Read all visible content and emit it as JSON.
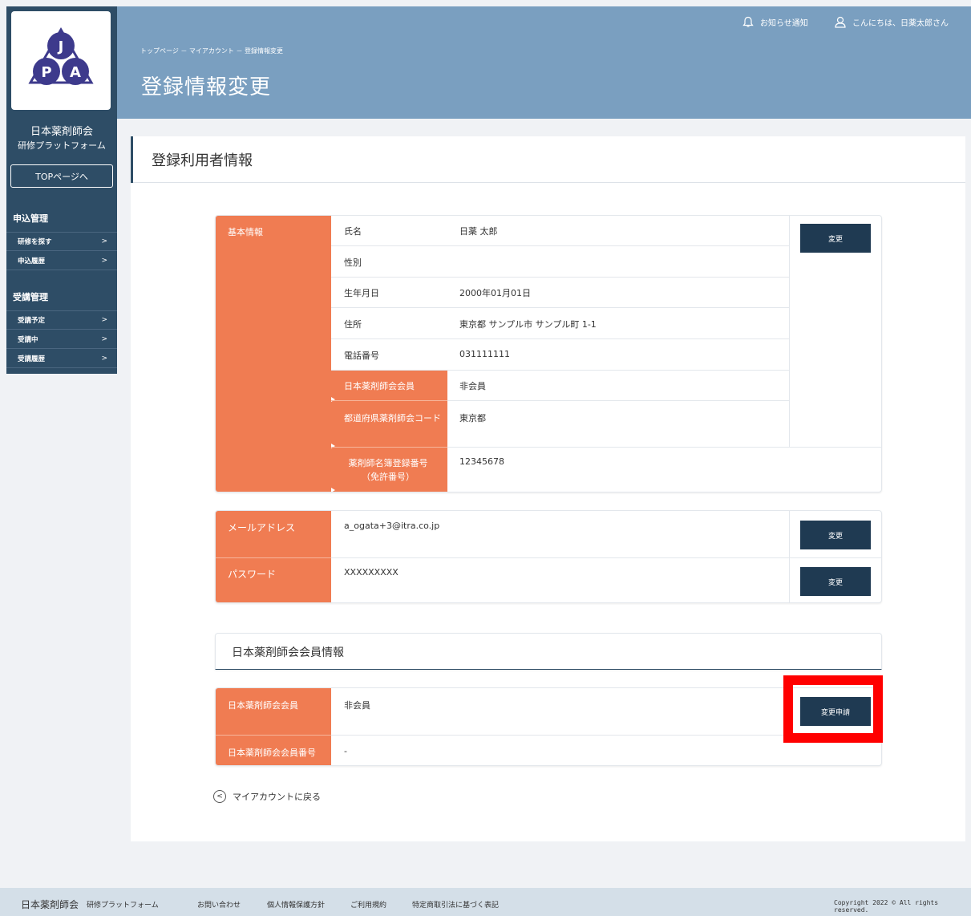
{
  "header": {
    "notifications": "お知らせ通知",
    "greeting": "こんにちは、日薬太郎さん",
    "breadcrumb": "トップページ － マイアカウント － 登録情報変更",
    "page_title": "登録情報変更"
  },
  "sidebar": {
    "logo_text": "JPA",
    "org_name": "日本薬剤師会",
    "org_sub": "研修プラットフォーム",
    "top_button": "TOPページへ",
    "sections": [
      {
        "title": "申込管理",
        "items": [
          "研修を探す",
          "申込履歴"
        ]
      },
      {
        "title": "受講管理",
        "items": [
          "受講予定",
          "受講中",
          "受講履歴"
        ]
      }
    ],
    "chevron": ">"
  },
  "card": {
    "title": "登録利用者情報",
    "basic": {
      "section_label": "基本情報",
      "rows": [
        {
          "label": "氏名",
          "value": "日薬 太郎"
        },
        {
          "label": "性別",
          "value": ""
        },
        {
          "label": "生年月日",
          "value": "2000年01月01日"
        },
        {
          "label": "住所",
          "value": "東京都 サンプル市 サンプル町 1-1"
        },
        {
          "label": "電話番号",
          "value": "031111111"
        },
        {
          "label": "日本薬剤師会会員",
          "value": "非会員"
        },
        {
          "label": "都道府県薬剤師会コード",
          "value": "東京都"
        },
        {
          "label": "薬剤師名簿登録番号（免許番号）",
          "value": "12345678"
        }
      ],
      "change_button": "変更"
    },
    "account": {
      "email_label": "メールアドレス",
      "email_value": "a_ogata+3@itra.co.jp",
      "email_button": "変更",
      "password_label": "パスワード",
      "password_value": "XXXXXXXXX",
      "password_button": "変更"
    },
    "member": {
      "title": "日本薬剤師会会員情報",
      "member_label": "日本薬剤師会会員",
      "member_value": "非会員",
      "member_number_label": "日本薬剤師会会員番号",
      "member_number_value": "-",
      "change_request_button": "変更申請"
    },
    "back_link": "マイアカウントに戻る",
    "back_icon": "<"
  },
  "footer": {
    "org_name": "日本薬剤師会",
    "org_sub": "研修プラットフォーム",
    "links": [
      "お問い合わせ",
      "個人情報保護方針",
      "ご利用規約",
      "特定商取引法に基づく表記"
    ],
    "copyright": "Copyright 2022 © All rights reserved."
  },
  "colors": {
    "sidebar": "#2e4d66",
    "header": "#7a9fc0",
    "accent_orange": "#f07c52",
    "button_dark": "#1f3a52",
    "highlight_red": "#ff0000"
  }
}
